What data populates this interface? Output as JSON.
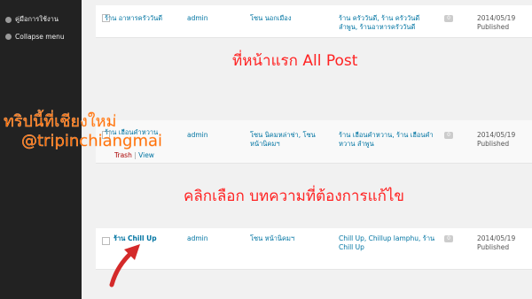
{
  "sidebar": {
    "items": [
      {
        "label": "คู่มือการใช้งาน",
        "icon": "doc-icon"
      },
      {
        "label": "Collapse menu",
        "icon": "collapse-icon"
      }
    ]
  },
  "rows": [
    {
      "title": "ร้าน อาหารครัววันดี",
      "author": "admin",
      "categories": "โซน นอกเมือง",
      "tags": "ร้าน ครัววันดี, ร้าน ครัววันดี ลำพูน, ร้านอาหารครัววันดี",
      "comments": "0",
      "date": "2014/05/19",
      "status": "Published"
    },
    {
      "title": "ร้าน เฮือนคำหวาน",
      "author": "admin",
      "categories": "โซน นิคมหล่าช่า, โซน หน้านิคมฯ",
      "tags": "ร้าน เฮือนคำหวาน, ร้าน เฮือนคำ หวาน ลำพูน",
      "comments": "0",
      "date": "2014/05/19",
      "status": "Published",
      "actions": {
        "trash": "Trash",
        "sep": "|",
        "view": "View"
      }
    },
    {
      "title": "ร้าน Chill Up",
      "author": "admin",
      "categories": "โซน หน้านิคมฯ",
      "tags": "Chill Up, Chillup lamphu, ร้าน Chill Up",
      "comments": "0",
      "date": "2014/05/19",
      "status": "Published"
    }
  ],
  "annotations": {
    "first_page": "ที่หน้าแรก All Post",
    "select_post": "คลิกเลือก บทความที่ต้องการแก้ไข",
    "watermark_line1": "ทริปนี้ที่เชียงใหม่",
    "watermark_line2": "@tripinchiangmai"
  },
  "colors": {
    "sidebar_bg": "#222222",
    "link": "#0074a2",
    "annotation": "#ff2222",
    "watermark": "#ff6a00"
  }
}
